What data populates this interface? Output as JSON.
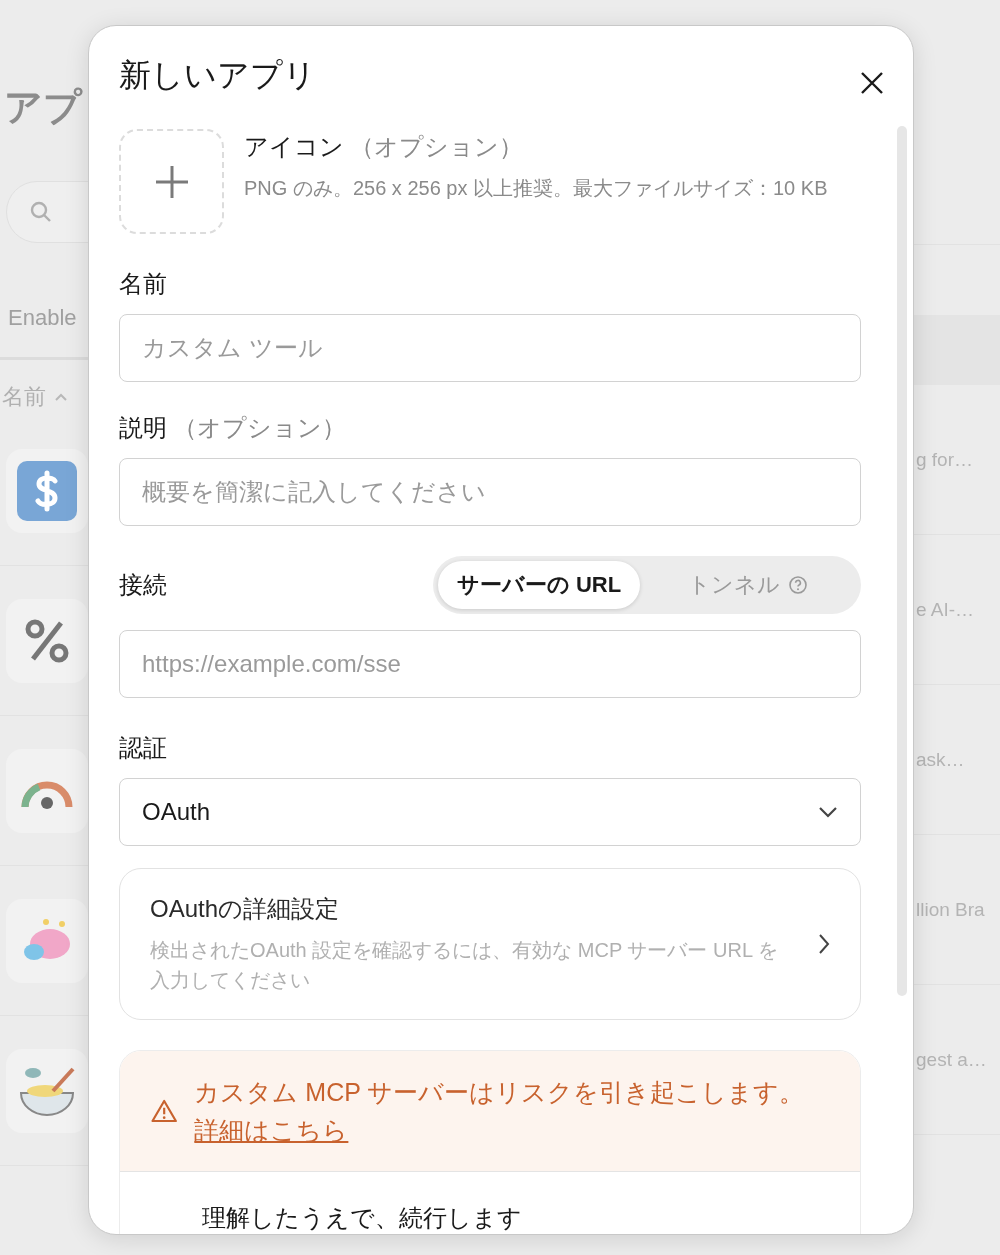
{
  "background": {
    "page_title": "アプ",
    "tab": "Enable",
    "sort_column": {
      "label": "名前"
    },
    "rows": [
      {
        "kind": "dollar",
        "description": "g for…"
      },
      {
        "kind": "percent",
        "description": "e AI-…"
      },
      {
        "kind": "gauge",
        "description": "ask…"
      },
      {
        "kind": "brain",
        "description": "llion Bra"
      },
      {
        "kind": "bowl",
        "description": "gest a…"
      }
    ]
  },
  "dialog": {
    "title": "新しいアプリ",
    "icon_upload": {
      "label": "アイコン",
      "optional": "（オプション）",
      "hint": "PNG のみ。256 x 256 px 以上推奨。最大ファイルサイズ：10 KB"
    },
    "name": {
      "label": "名前",
      "placeholder": "カスタム ツール"
    },
    "description": {
      "label": "説明",
      "optional": "（オプション）",
      "placeholder": "概要を簡潔に記入してください"
    },
    "connection": {
      "label": "接続",
      "options": [
        {
          "label": "サーバーの URL",
          "selected": true,
          "help": false
        },
        {
          "label": "トンネル",
          "selected": false,
          "help": true
        }
      ],
      "placeholder": "https://example.com/sse"
    },
    "auth": {
      "label": "認証",
      "value": "OAuth"
    },
    "advanced": {
      "title": "OAuthの詳細設定",
      "description": "検出されたOAuth 設定を確認するには、有効な MCP サーバー URL を入力してください"
    },
    "warning": {
      "text": "カスタム MCP サーバーはリスクを引き起こします。",
      "link": "詳細はこちら"
    },
    "acknowledge": {
      "label": "理解したうえで、続行します"
    }
  }
}
